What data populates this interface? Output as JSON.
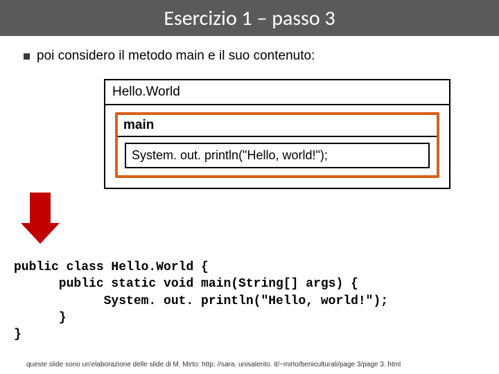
{
  "title": "Esercizio 1 – passo 3",
  "bullet": "poi considero il metodo main e il suo contenuto:",
  "diagram": {
    "outerLabel": "Hello.World",
    "mainLabel": "main",
    "innerStatement": "System. out. println(\"Hello, world!\");"
  },
  "code": {
    "line1": "public class Hello.World {",
    "line2": "      public static void main(String[] args) {",
    "line3": "            System. out. println(\"Hello, world!\");",
    "line4": "      }",
    "line5": "}"
  },
  "footer": "queste slide sono un'elaborazione delle slide di M. Mirto: http: //sara. unisalento. it/~mirto/beniculturali/page 3/page 3. html"
}
